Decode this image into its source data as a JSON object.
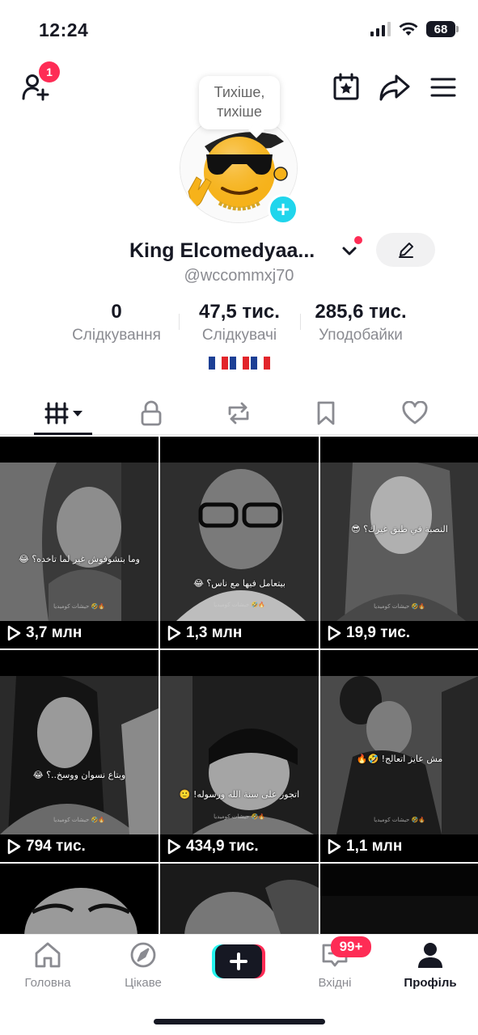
{
  "status": {
    "time": "12:24",
    "battery": "68"
  },
  "top": {
    "notifications_count": "1"
  },
  "profile": {
    "tooltip": "Тихіше, тихіше",
    "display_name": "King Elcomedyaa...",
    "username": "@wccommxj70",
    "stats": [
      {
        "value": "0",
        "label": "Слідкування"
      },
      {
        "value": "47,5 тис.",
        "label": "Слідкувачі"
      },
      {
        "value": "285,6 тис.",
        "label": "Уподобайки"
      }
    ]
  },
  "videos": [
    {
      "views": "3,7 млн",
      "caption": "وما بتشوفوش غير لما تاخده؟ 😂",
      "watermark": "حيشات كوميديا 🤣🔥"
    },
    {
      "views": "1,3 млн",
      "caption": "بيتعامل فيها مع ناس؟ 😂",
      "watermark": "حيشات كوميديا 🤣🔥"
    },
    {
      "views": "19,9 тис.",
      "caption": "النصبة في طبق غيرك؟ 😎",
      "watermark": "حيشات كوميديا 🤣🔥"
    },
    {
      "views": "794 тис.",
      "caption": "وبتاع نسوان ووسخ..؟ 😂",
      "watermark": "حيشات كوميديا 🤣🔥"
    },
    {
      "views": "434,9 тис.",
      "caption": "اتجوز على سنة الله ورسوله! 🙂",
      "watermark": "حيشات كوميديا 🤣🔥"
    },
    {
      "views": "1,1 млн",
      "caption": "مش عايز اتعالج! 🤣🔥",
      "watermark": "حيشات كوميديا 🤣🔥"
    }
  ],
  "nav": {
    "home": "Головна",
    "discover": "Цікаве",
    "inbox": "Вхідні",
    "inbox_badge": "99+",
    "profile": "Профіль"
  },
  "colors": {
    "accent": "#fe2c55",
    "cyan": "#20d5ec",
    "text": "#161823",
    "muted": "#8a8b91"
  }
}
